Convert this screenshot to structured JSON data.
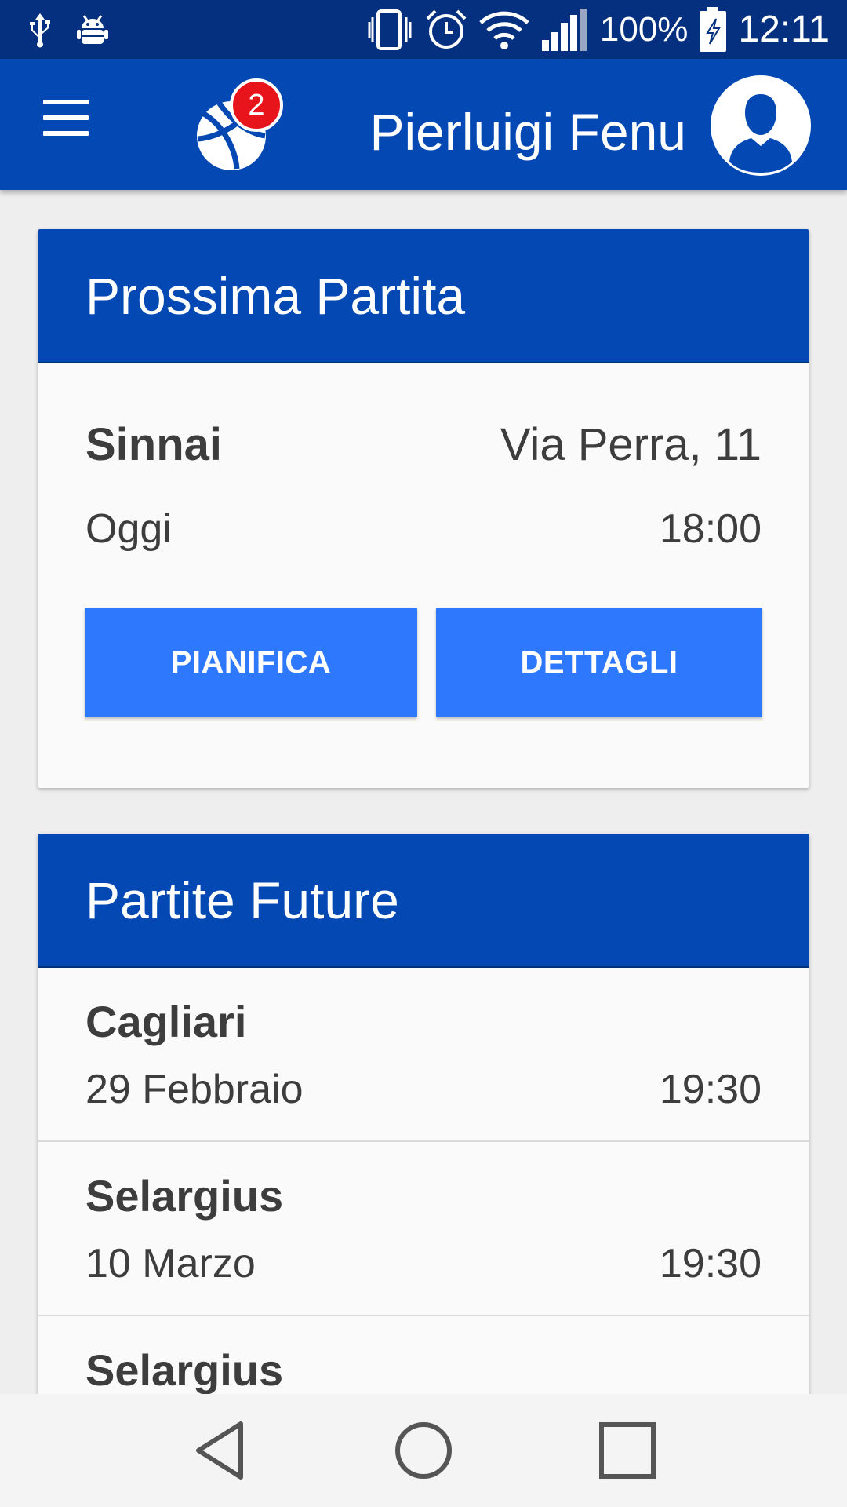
{
  "status_bar": {
    "battery_percent": "100%",
    "time": "12:11",
    "icons": [
      "usb-icon",
      "android-debug-icon",
      "vibrate-icon",
      "alarm-icon",
      "wifi-icon",
      "signal-icon",
      "battery-charging-icon"
    ]
  },
  "app_bar": {
    "notification_count": "2",
    "user_name": "Pierluigi Fenu",
    "icons": [
      "menu-icon",
      "basketball-logo-icon",
      "user-avatar-icon"
    ]
  },
  "next_match": {
    "title": "Prossima Partita",
    "city": "Sinnai",
    "address": "Via Perra, 11",
    "day": "Oggi",
    "time": "18:00",
    "plan_label": "PIANIFICA",
    "details_label": "DETTAGLI"
  },
  "future_matches": {
    "title": "Partite Future",
    "items": [
      {
        "city": "Cagliari",
        "date": "29 Febbraio",
        "time": "19:30"
      },
      {
        "city": "Selargius",
        "date": "10 Marzo",
        "time": "19:30"
      },
      {
        "city": "Selargius",
        "date": "",
        "time": ""
      }
    ]
  },
  "nav_bar": {
    "icons": [
      "back-icon",
      "home-icon",
      "recents-icon"
    ]
  },
  "colors": {
    "status_bar": "#05307f",
    "primary": "#0348b3",
    "button": "#2e78fe",
    "badge": "#e8141b",
    "text": "#3d3d3d"
  }
}
